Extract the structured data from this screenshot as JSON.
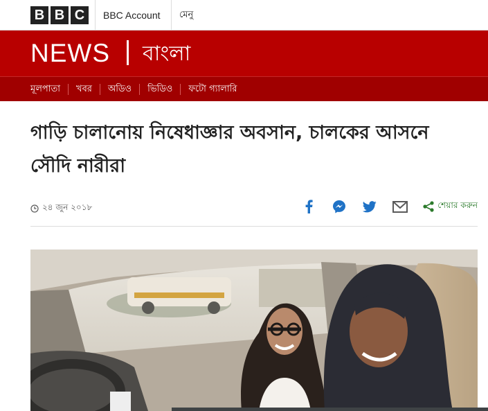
{
  "topbar": {
    "logo_letters": [
      "B",
      "B",
      "C"
    ],
    "account_label": "BBC Account",
    "menu_label": "মেনু"
  },
  "masthead": {
    "news": "NEWS",
    "service": "বাংলা",
    "brand_color": "#b80000"
  },
  "nav": {
    "items": [
      {
        "label": "মূলপাতা"
      },
      {
        "label": "খবর"
      },
      {
        "label": "অডিও"
      },
      {
        "label": "ভিডিও"
      },
      {
        "label": "ফটো গ্যালারি"
      }
    ]
  },
  "article": {
    "headline_line1": "গাড়ি চালানোয় নিষেধাজ্ঞার অবসান, চালকের আসনে",
    "headline_line2": "সৌদি নারীরা",
    "date": "২৪ জুন ২০১৮",
    "share_label": "শেয়ার করুন",
    "share_icons": [
      "facebook-icon",
      "messenger-icon",
      "twitter-icon",
      "email-icon",
      "share-icon"
    ],
    "share_color": "#2b7a2b",
    "icon_blue": "#1f72c6"
  }
}
